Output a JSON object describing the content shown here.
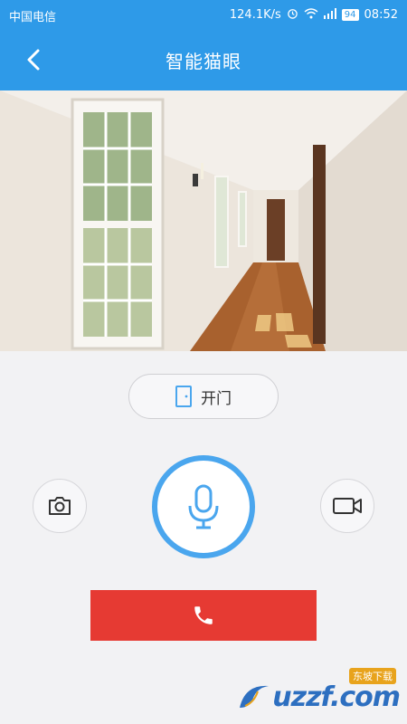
{
  "status_bar": {
    "carrier": "中国电信",
    "speed": "124.1K/s",
    "battery": "94",
    "time": "08:52"
  },
  "header": {
    "title": "智能猫眼"
  },
  "controls": {
    "open_door_label": "开门"
  },
  "watermark": {
    "text": "uzzf.com",
    "tag": "东坡下载"
  },
  "colors": {
    "primary": "#2e9ae8",
    "mic_ring": "#4aa6ee",
    "hangup": "#e63a33",
    "background": "#f2f2f4"
  },
  "icons": {
    "back": "chevron-left-icon",
    "door": "door-icon",
    "camera": "camera-icon",
    "mic": "microphone-icon",
    "video": "video-camera-icon",
    "phone": "phone-icon"
  }
}
